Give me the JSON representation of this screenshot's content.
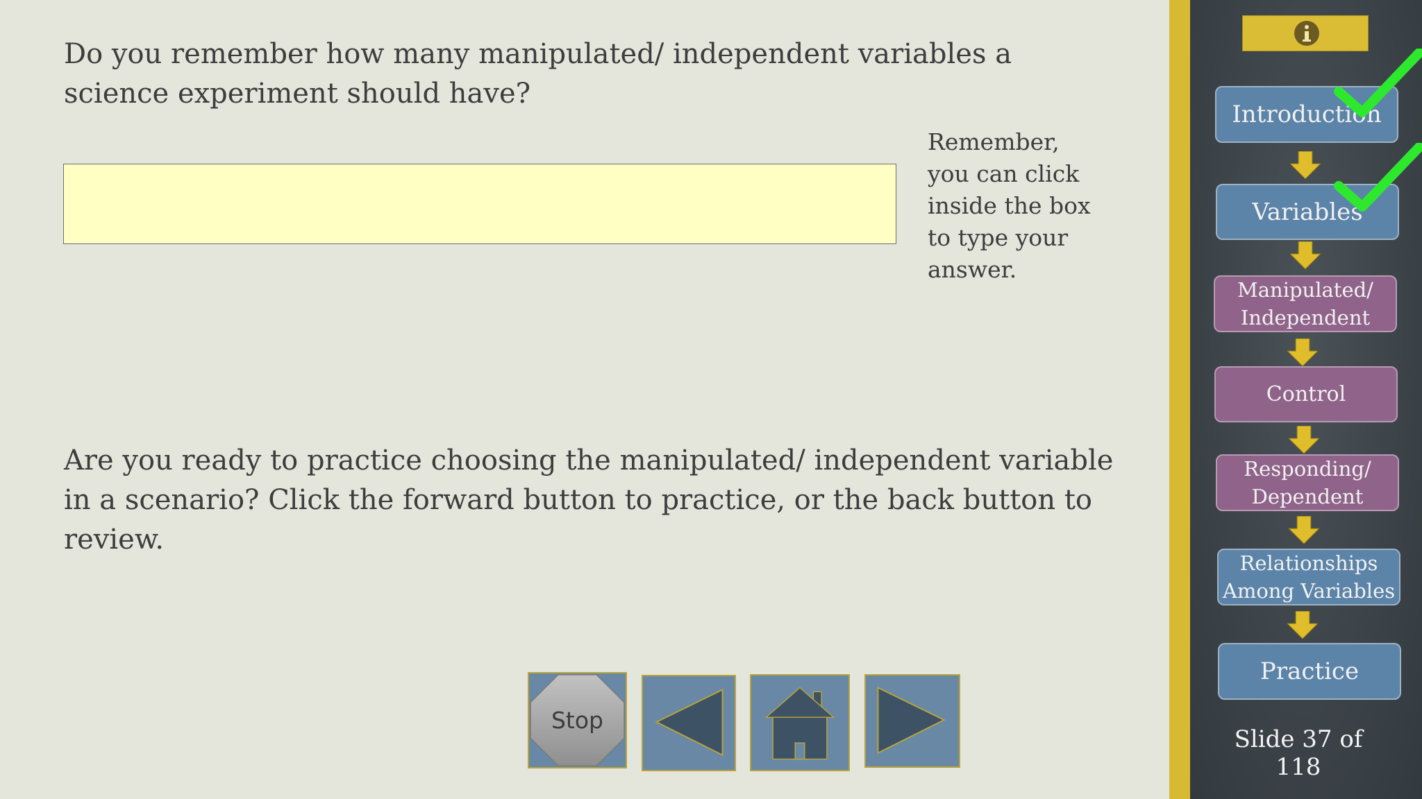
{
  "main": {
    "question": "Do you remember how many manipulated/ independent variables a science experiment should have?",
    "answer_value": "",
    "hint": "Remember, you can click inside the box to type your answer.",
    "prompt": "Are you ready to practice choosing the manipulated/ independent variable in a scenario?  Click the forward button to practice, or the back button to review."
  },
  "controls": {
    "stop_label": "Stop",
    "back_icon": "triangle-left-icon",
    "home_icon": "house-icon",
    "forward_icon": "triangle-right-icon"
  },
  "sidebar": {
    "info_icon": "info-icon",
    "steps": [
      {
        "label_line1": "Introduction",
        "label_line2": "",
        "color": "blue",
        "completed": true
      },
      {
        "label_line1": "Variables",
        "label_line2": "",
        "color": "blue",
        "completed": true
      },
      {
        "label_line1": "Manipulated/",
        "label_line2": "Independent",
        "color": "purple",
        "completed": false
      },
      {
        "label_line1": "Control",
        "label_line2": "",
        "color": "purple",
        "completed": false
      },
      {
        "label_line1": "Responding/",
        "label_line2": "Dependent",
        "color": "purple",
        "completed": false
      },
      {
        "label_line1": "Relationships",
        "label_line2": "Among Variables",
        "color": "blue",
        "completed": false
      },
      {
        "label_line1": "Practice",
        "label_line2": "",
        "color": "blue",
        "completed": false
      }
    ],
    "slide_counter": "Slide 37 of 118"
  },
  "colors": {
    "background": "#e4e6dc",
    "answer_box": "#ffffc4",
    "nav_button": "#6888a6",
    "step_blue": "#5c84a8",
    "step_purple": "#90648a",
    "accent_gold": "#d7b934",
    "check_green": "#2ee82e"
  }
}
